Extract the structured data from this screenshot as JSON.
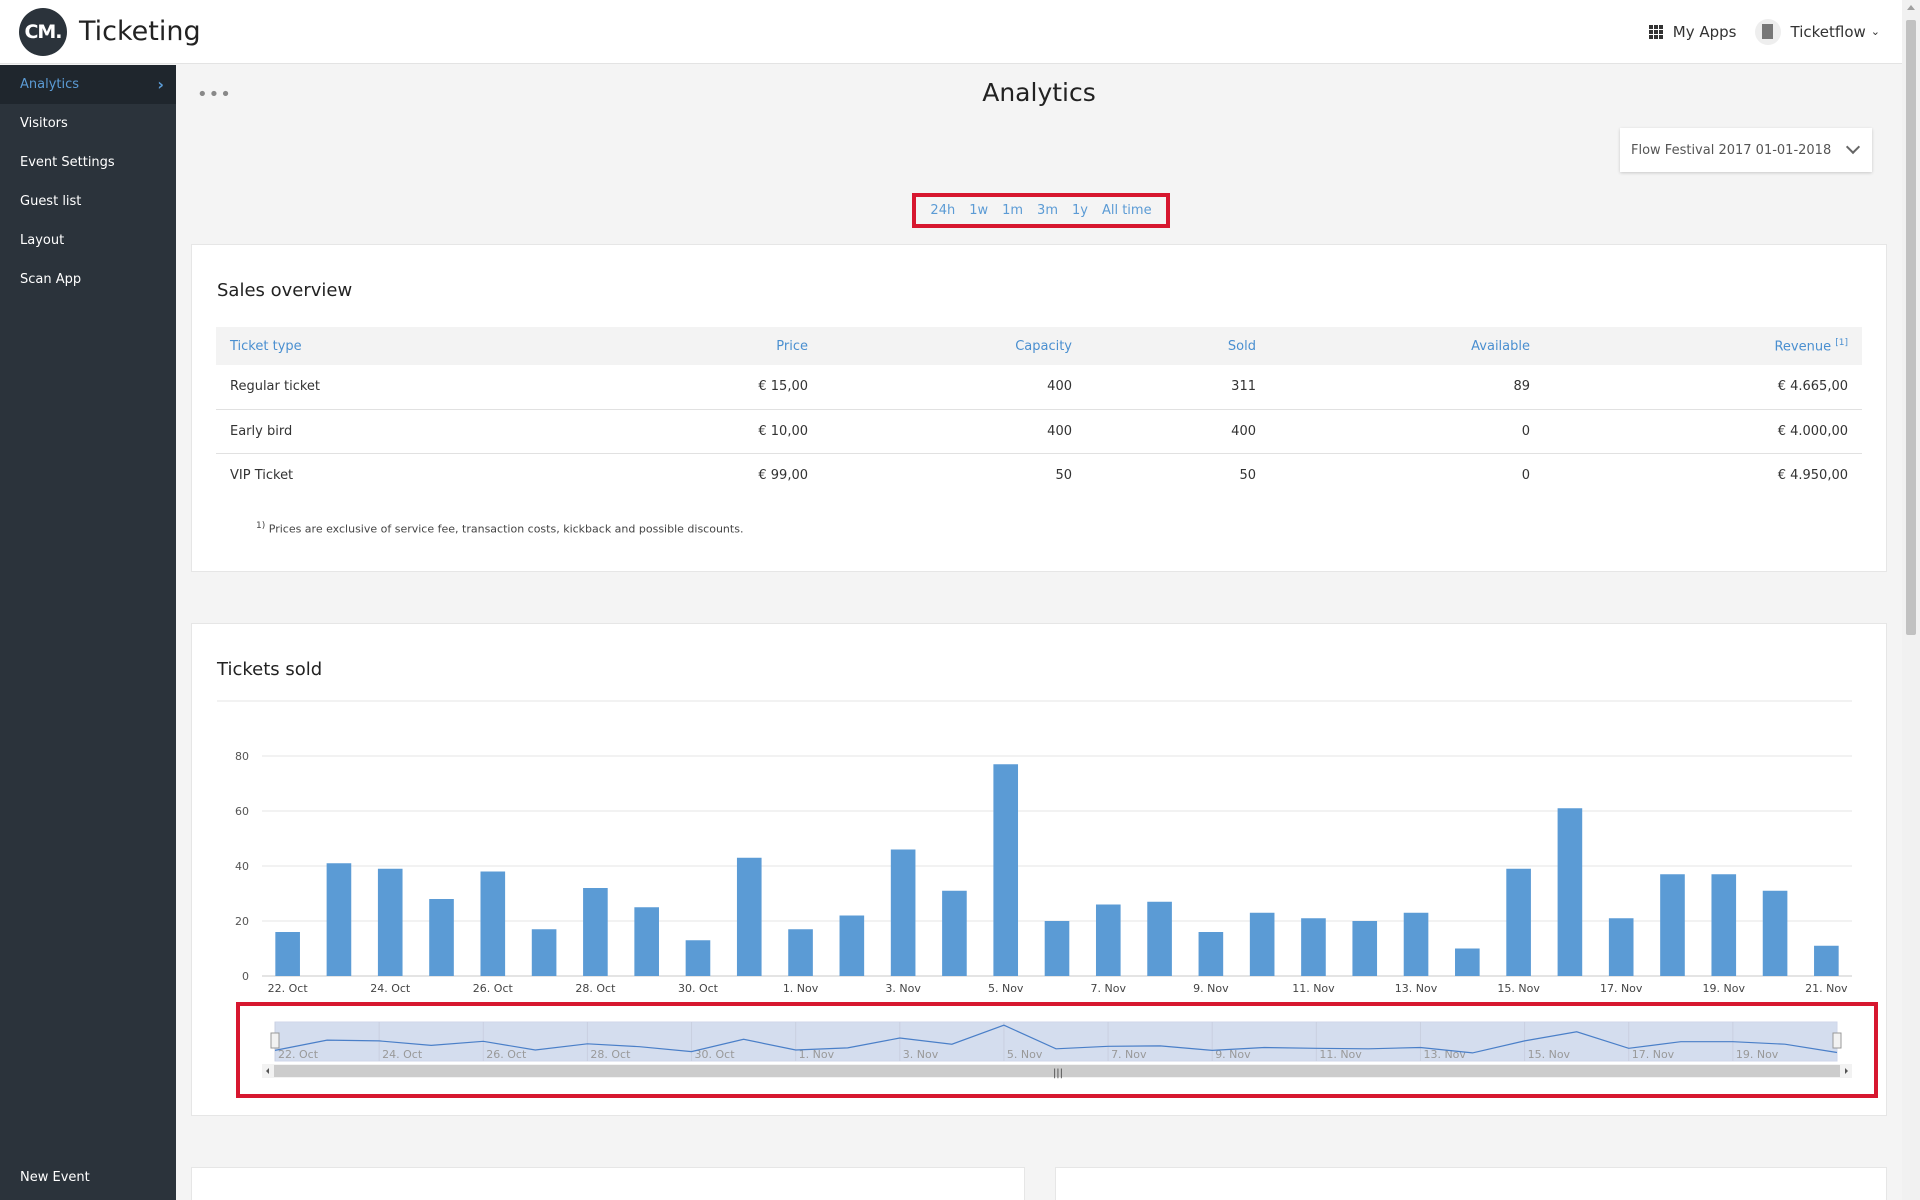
{
  "header": {
    "logo_text": "CM.",
    "app_title": "Ticketing",
    "my_apps_label": "My Apps",
    "account_label": "Ticketflow"
  },
  "sidebar": {
    "items": [
      {
        "label": "Analytics",
        "active": true
      },
      {
        "label": "Visitors"
      },
      {
        "label": "Event Settings"
      },
      {
        "label": "Guest list"
      },
      {
        "label": "Layout"
      },
      {
        "label": "Scan App"
      }
    ],
    "bottom_label": "New Event"
  },
  "page": {
    "title": "Analytics",
    "more_icon": "•••",
    "event_select_value": "Flow Festival 2017 01-01-2018",
    "time_ranges": [
      "24h",
      "1w",
      "1m",
      "3m",
      "1y",
      "All time"
    ]
  },
  "sales": {
    "title": "Sales overview",
    "columns": [
      "Ticket type",
      "Price",
      "Capacity",
      "Sold",
      "Available",
      "Revenue"
    ],
    "revenue_note_marker": "[1]",
    "rows": [
      [
        "Regular ticket",
        "€ 15,00",
        "400",
        "311",
        "89",
        "€ 4.665,00"
      ],
      [
        "Early bird",
        "€ 10,00",
        "400",
        "400",
        "0",
        "€ 4.000,00"
      ],
      [
        "VIP Ticket",
        "€ 99,00",
        "50",
        "50",
        "0",
        "€ 4.950,00"
      ]
    ],
    "footnote_marker": "1)",
    "footnote": "Prices are exclusive of service fee, transaction costs, kickback and possible discounts."
  },
  "tickets": {
    "title": "Tickets sold"
  },
  "colors": {
    "accent": "#5b9bd5",
    "sidebar_bg": "#2b333b",
    "highlight": "#d7172f",
    "bar": "#5b9bd5"
  },
  "chart_data": {
    "type": "bar",
    "ylim": [
      0,
      80
    ],
    "yticks": [
      0,
      20,
      40,
      60,
      80
    ],
    "tick_labels": [
      "22. Oct",
      "24. Oct",
      "26. Oct",
      "28. Oct",
      "30. Oct",
      "1. Nov",
      "3. Nov",
      "5. Nov",
      "7. Nov",
      "9. Nov",
      "11. Nov",
      "13. Nov",
      "15. Nov",
      "17. Nov",
      "19. Nov",
      "21. Nov"
    ],
    "values": [
      16,
      41,
      39,
      28,
      38,
      17,
      32,
      25,
      13,
      43,
      17,
      22,
      46,
      31,
      77,
      20,
      26,
      27,
      16,
      23,
      21,
      20,
      23,
      10,
      39,
      61,
      21,
      37,
      37,
      31,
      11
    ],
    "navigator_labels": [
      "22. Oct",
      "24. Oct",
      "26. Oct",
      "28. Oct",
      "30. Oct",
      "1. Nov",
      "3. Nov",
      "5. Nov",
      "7. Nov",
      "9. Nov",
      "11. Nov",
      "13. Nov",
      "15. Nov",
      "17. Nov",
      "19. Nov"
    ]
  }
}
